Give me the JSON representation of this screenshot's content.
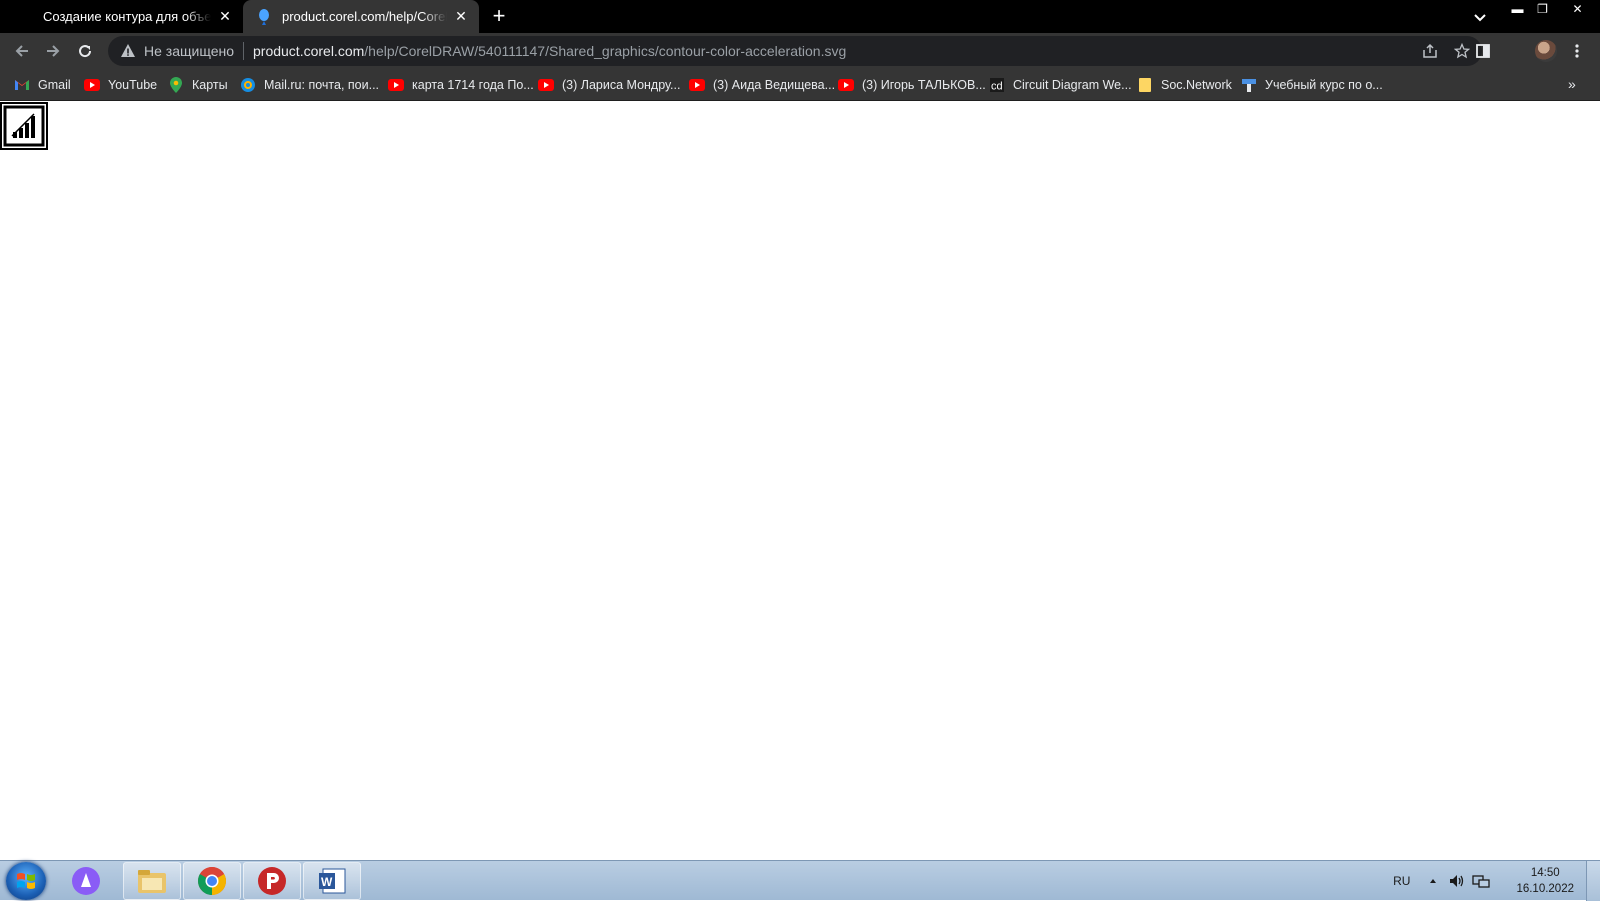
{
  "browser": {
    "tabs": [
      {
        "title": "Создание контура для объектов",
        "active": false
      },
      {
        "title": "product.corel.com/help/CorelDRAW",
        "active": true
      }
    ],
    "address_bar": {
      "security_label": "Не защищено",
      "url_host": "product.corel.com",
      "url_path": "/help/CorelDRAW/540111147/Shared_graphics/contour-color-acceleration.svg"
    },
    "bookmarks": [
      {
        "label": "Gmail",
        "icon": "gmail-icon"
      },
      {
        "label": "YouTube",
        "icon": "youtube-icon"
      },
      {
        "label": "Карты",
        "icon": "maps-icon"
      },
      {
        "label": "Mail.ru: почта, пои...",
        "icon": "mailru-icon"
      },
      {
        "label": "карта 1714 года По...",
        "icon": "youtube-icon"
      },
      {
        "label": "(3) Лариса Мондру...",
        "icon": "youtube-icon"
      },
      {
        "label": "(3) Аида Ведищева...",
        "icon": "youtube-icon"
      },
      {
        "label": "(3) Игорь ТАЛЬКОВ...",
        "icon": "youtube-icon"
      },
      {
        "label": "Circuit Diagram We...",
        "icon": "circuit-diagram-icon"
      },
      {
        "label": "Soc.Network",
        "icon": "folder-icon"
      },
      {
        "label": "Учебный курс по о...",
        "icon": "course-icon"
      }
    ],
    "bookmarks_overflow": "»"
  },
  "taskbar": {
    "language": "RU",
    "time": "14:50",
    "date": "16.10.2022",
    "apps": [
      "alice-assistant",
      "file-explorer",
      "chrome",
      "punto-switcher",
      "microsoft-word"
    ]
  },
  "colors": {
    "tab_strip": "#000000",
    "toolbar": "#353535",
    "omnibox": "#202124",
    "page_background": "#ffffff",
    "taskbar": "#a9c0d8"
  }
}
